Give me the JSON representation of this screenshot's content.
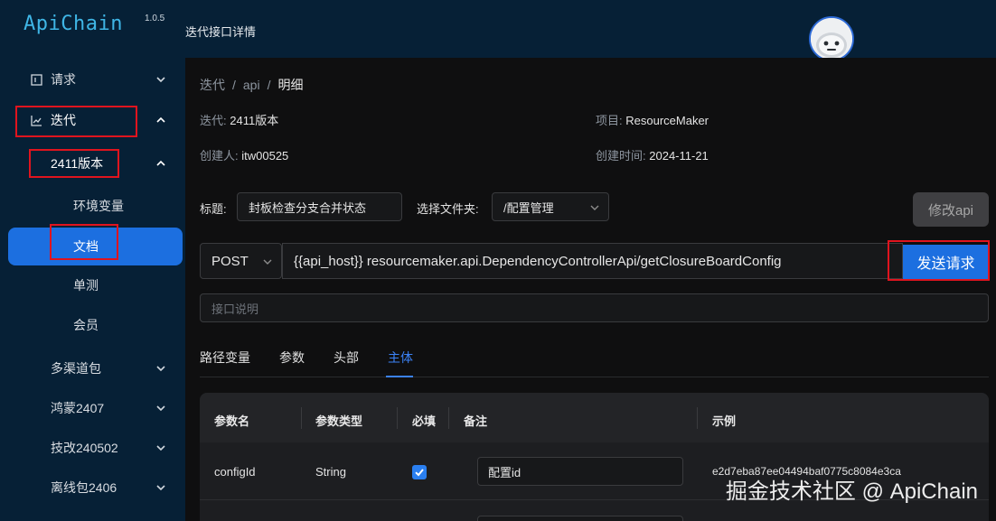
{
  "app": {
    "name": "ApiChain",
    "version": "1.0.5",
    "page_title": "迭代接口详情"
  },
  "sidebar": {
    "items": [
      {
        "label": "请求"
      },
      {
        "label": "迭代"
      },
      {
        "label": "2411版本"
      },
      {
        "label": "环境变量"
      },
      {
        "label": "文档"
      },
      {
        "label": "单测"
      },
      {
        "label": "会员"
      },
      {
        "label": "多渠道包"
      },
      {
        "label": "鸿蒙2407"
      },
      {
        "label": "技改240502"
      },
      {
        "label": "离线包2406"
      }
    ]
  },
  "breadcrumb": {
    "items": [
      "迭代",
      "api",
      "明细"
    ]
  },
  "meta": {
    "iteration_label": "迭代:",
    "iteration_value": "2411版本",
    "project_label": "项目:",
    "project_value": "ResourceMaker",
    "creator_label": "创建人:",
    "creator_value": "itw00525",
    "created_label": "创建时间:",
    "created_value": "2024-11-21"
  },
  "form": {
    "title_label": "标题:",
    "title_value": "封板检查分支合并状态",
    "folder_label": "选择文件夹:",
    "folder_value": "/配置管理",
    "edit_button": "修改api",
    "method": "POST",
    "url": "{{api_host}} resourcemaker.api.DependencyControllerApi/getClosureBoardConfig",
    "send_button": "发送请求",
    "desc_placeholder": "接口说明"
  },
  "tabs": [
    {
      "label": "路径变量"
    },
    {
      "label": "参数"
    },
    {
      "label": "头部"
    },
    {
      "label": "主体"
    }
  ],
  "table": {
    "headers": [
      "参数名",
      "参数类型",
      "必填",
      "备注",
      "示例"
    ],
    "rows": [
      {
        "name": "configId",
        "type": "String",
        "required": true,
        "note": "配置id",
        "example": "e2d7eba87ee04494baf0775c8084e3ca"
      }
    ]
  },
  "overlay": {
    "watermark": "掘金技术社区 @ ApiChain"
  },
  "colors": {
    "accent": "#1c6fe0",
    "sidebar": "#062036",
    "highlight_box": "#e0141e"
  }
}
